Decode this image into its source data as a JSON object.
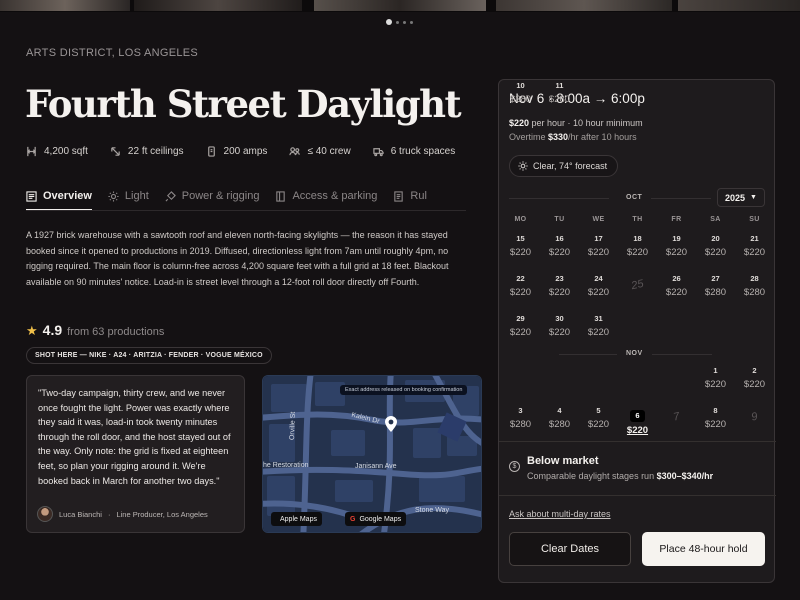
{
  "location": "ARTS DISTRICT, LOS ANGELES",
  "title": "Fourth Street Daylight",
  "specs": [
    {
      "icon": "area-icon",
      "label": "4,200 sqft"
    },
    {
      "icon": "ceiling-height-icon",
      "label": "22 ft ceilings"
    },
    {
      "icon": "power-icon",
      "label": "200 amps"
    },
    {
      "icon": "crew-icon",
      "label": "≤ 40 crew"
    },
    {
      "icon": "truck-icon",
      "label": "6 truck spaces"
    }
  ],
  "tabs": [
    {
      "icon": "overview-icon",
      "label": "Overview",
      "active": true
    },
    {
      "icon": "sun-icon",
      "label": "Light"
    },
    {
      "icon": "plug-icon",
      "label": "Power & rigging"
    },
    {
      "icon": "door-icon",
      "label": "Access & parking"
    },
    {
      "icon": "rules-icon",
      "label": "Rul"
    }
  ],
  "description": "A 1927 brick warehouse with a sawtooth roof and eleven north-facing skylights — the reason it has stayed booked since it opened to productions in 2019. Diffused, directionless light from 7am until roughly 4pm, no rigging required. The main floor is column-free across 4,200 square feet with a full grid at 18 feet. Blackout available on 90 minutes' notice. Load-in is street level through a 12-foot roll door directly off Fourth.",
  "rating": {
    "score": "4.9",
    "from": "from 63 productions"
  },
  "shot_here": "SHOT HERE — NIKE · A24 · ARITZIA · FENDER · VOGUE MÉXICO",
  "review": {
    "quote": "\"Two-day campaign, thirty crew, and we never once fought the light. Power was exactly where they said it was, load-in took twenty minutes through the roll door, and the host stayed out of the way. Only note: the grid is fixed at eighteen feet, so plan your rigging around it. We're booked back in March for another two days.\"",
    "author": "Luca Bianchi",
    "role": "Line Producer, Los Angeles"
  },
  "map": {
    "note": "Exact address released on booking confirmation",
    "streets": [
      "Kalein Dr",
      "Orville St",
      "Janisann Ave",
      "he Restoration",
      "Stone Way"
    ],
    "apple_label": "Apple Maps",
    "google_label": "Google Maps"
  },
  "booking": {
    "date_range": "Nov 6  ·  8:00a → 6:00p",
    "rate": "$220",
    "rate_suffix": " per hour  ·  10 hour minimum",
    "overtime_prefix": "Overtime ",
    "overtime_rate": "$330",
    "overtime_suffix": "/hr after 10 hours",
    "weather": "Clear, 74° forecast",
    "year": "2025",
    "weekdays": [
      "MO",
      "TU",
      "WE",
      "TH",
      "FR",
      "SA",
      "SU"
    ],
    "oct_label": "OCT",
    "nov_label": "NOV",
    "oct_days": [
      {
        "d": "15",
        "p": "$220"
      },
      {
        "d": "16",
        "p": "$220"
      },
      {
        "d": "17",
        "p": "$220"
      },
      {
        "d": "18",
        "p": "$220"
      },
      {
        "d": "19",
        "p": "$220"
      },
      {
        "d": "20",
        "p": "$220"
      },
      {
        "d": "21",
        "p": "$220"
      },
      {
        "d": "22",
        "p": "$220"
      },
      {
        "d": "23",
        "p": "$220"
      },
      {
        "d": "24",
        "p": "$220"
      },
      {
        "d": "25",
        "p": "",
        "na": true
      },
      {
        "d": "26",
        "p": "$220"
      },
      {
        "d": "27",
        "p": "$280"
      },
      {
        "d": "28",
        "p": "$280"
      },
      {
        "d": "29",
        "p": "$220"
      },
      {
        "d": "30",
        "p": "$220"
      },
      {
        "d": "31",
        "p": "$220"
      }
    ],
    "nov_days": [
      {
        "d": "1",
        "p": "$220"
      },
      {
        "d": "2",
        "p": "$220"
      },
      {
        "d": "3",
        "p": "$280"
      },
      {
        "d": "4",
        "p": "$280"
      },
      {
        "d": "5",
        "p": "$220"
      },
      {
        "d": "6",
        "p": "$220",
        "sel": true
      },
      {
        "d": "7",
        "p": "",
        "na": true
      },
      {
        "d": "8",
        "p": "$220"
      },
      {
        "d": "9",
        "p": "",
        "na": true
      },
      {
        "d": "10",
        "p": "$280"
      },
      {
        "d": "11",
        "p": "$280"
      }
    ],
    "market_title": "Below market",
    "market_text": "Comparable daylight stages run ",
    "market_range": "$300–$340/hr",
    "multi_day": "Ask about multi-day rates",
    "clear_label": "Clear Dates",
    "hold_label": "Place 48-hour hold"
  },
  "colors": {
    "background": "#141113",
    "panel": "#1e1b1d",
    "star": "#f1c04a",
    "accent": "#f6f3ef"
  }
}
